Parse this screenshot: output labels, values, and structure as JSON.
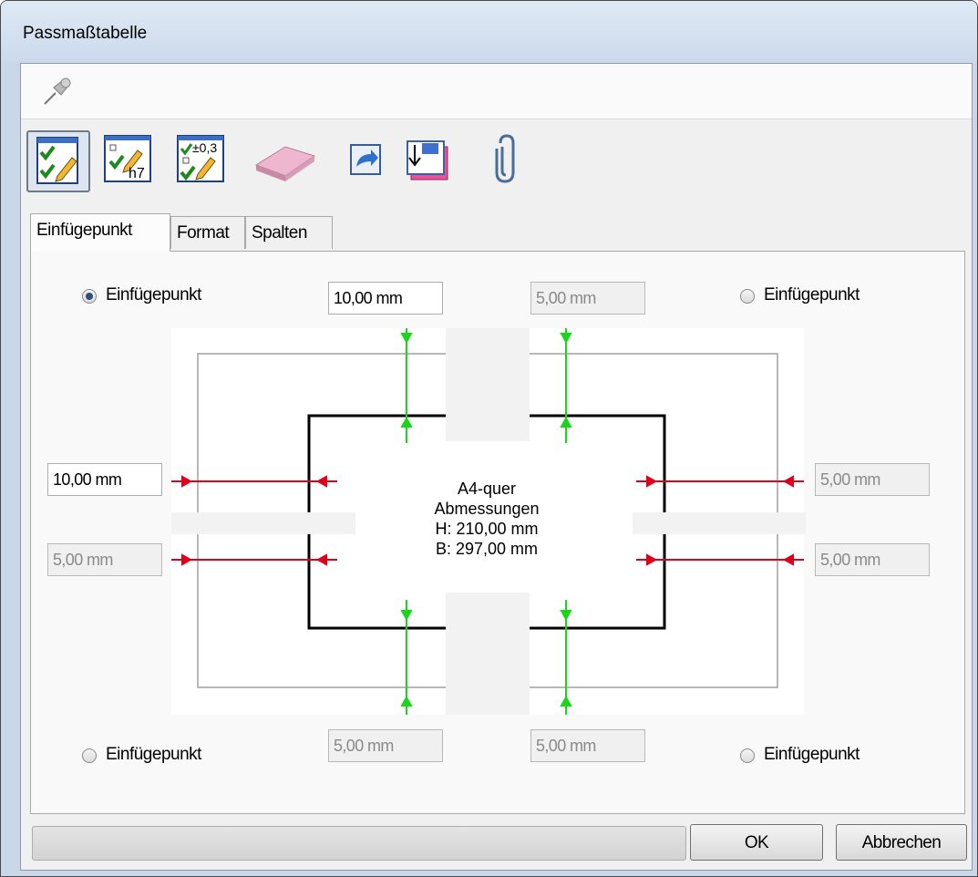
{
  "window": {
    "title": "Passmaßtabelle"
  },
  "pinbar": {
    "pin_icon": "pushpin-icon"
  },
  "toolbar": {
    "buttons": [
      {
        "icon": "checklist-edit-icon",
        "active": true
      },
      {
        "icon": "checklist-tolerance-h7-icon",
        "text": "h7"
      },
      {
        "icon": "checklist-tolerance-value-icon",
        "text": "±0,3"
      },
      {
        "icon": "eraser-icon"
      },
      {
        "icon": "refresh-icon"
      },
      {
        "icon": "save-import-icon"
      },
      {
        "icon": "paperclip-icon"
      }
    ]
  },
  "tabs": [
    {
      "label": "Einfügepunkt",
      "selected": true
    },
    {
      "label": "Format",
      "selected": false
    },
    {
      "label": "Spalten",
      "selected": false
    }
  ],
  "insertion": {
    "top_left": {
      "label": "Einfügepunkt",
      "checked": true
    },
    "top_right": {
      "label": "Einfügepunkt",
      "checked": false
    },
    "bottom_left": {
      "label": "Einfügepunkt",
      "checked": false
    },
    "bottom_right": {
      "label": "Einfügepunkt",
      "checked": false
    }
  },
  "margins": {
    "top_left": {
      "value": "10,00 mm",
      "enabled": true
    },
    "top_right": {
      "value": "5,00 mm",
      "enabled": false
    },
    "left_top": {
      "value": "10,00 mm",
      "enabled": true
    },
    "left_bottom": {
      "value": "5,00 mm",
      "enabled": false
    },
    "right_top": {
      "value": "5,00 mm",
      "enabled": false
    },
    "right_bottom": {
      "value": "5,00 mm",
      "enabled": false
    },
    "bottom_left": {
      "value": "5,00 mm",
      "enabled": false
    },
    "bottom_right": {
      "value": "5,00 mm",
      "enabled": false
    }
  },
  "paper": {
    "name": "A4-quer",
    "dims_label": "Abmessungen",
    "height": "H: 210,00 mm",
    "width": "B: 297,00 mm"
  },
  "colors": {
    "horizontal_arrow": "#e0001b",
    "vertical_arrow": "#19d619",
    "titlebar": "#cbdaeb"
  },
  "buttons": {
    "ok": "OK",
    "cancel": "Abbrechen"
  }
}
